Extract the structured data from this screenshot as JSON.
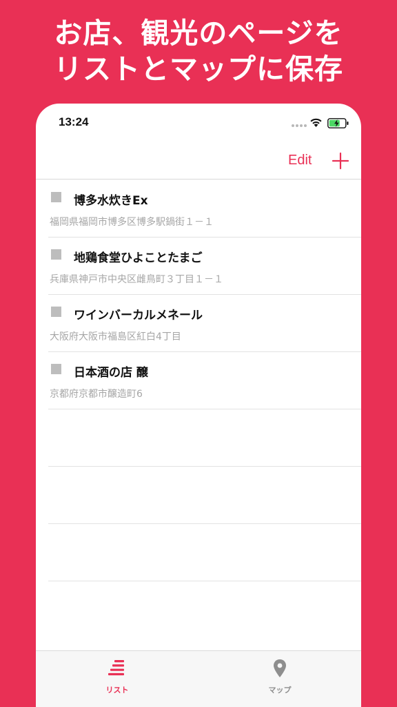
{
  "headline": {
    "line1": "お店、観光のページを",
    "line2": "リストとマップに保存"
  },
  "status_bar": {
    "time": "13:24"
  },
  "nav_bar": {
    "edit_label": "Edit"
  },
  "list": {
    "items": [
      {
        "title": "博多水炊きEx",
        "address": "福岡県福岡市博多区博多駅鍋街１－１"
      },
      {
        "title": "地鶏食堂ひよことたまご",
        "address": "兵庫県神戸市中央区雌鳥町３丁目１－１"
      },
      {
        "title": "ワインバーカルメネール",
        "address": "大阪府大阪市福島区紅白4丁目"
      },
      {
        "title": "日本酒の店 醸",
        "address": "京都府京都市醸造町6"
      }
    ]
  },
  "tab_bar": {
    "tabs": [
      {
        "label": "リスト",
        "icon": "list-icon",
        "active": true
      },
      {
        "label": "マップ",
        "icon": "map-pin-icon",
        "active": false
      }
    ]
  },
  "colors": {
    "accent": "#E93055",
    "inactive": "#8E8E8E",
    "battery": "#4CD964"
  }
}
